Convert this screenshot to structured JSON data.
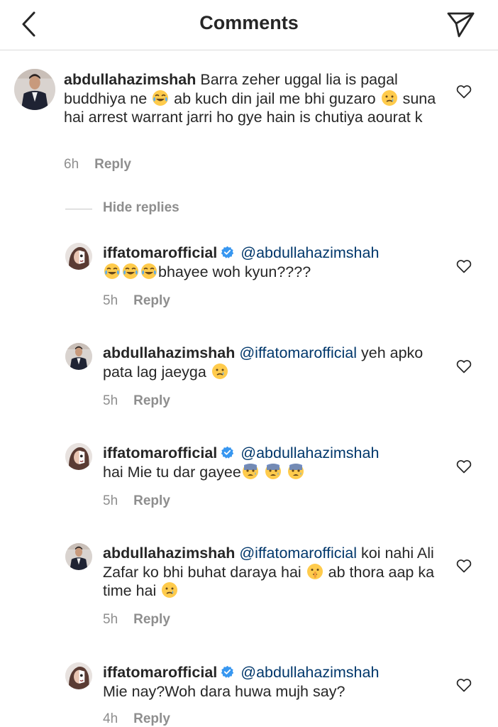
{
  "header": {
    "title": "Comments",
    "back_icon": "chevron-left-icon",
    "share_icon": "paper-plane-icon"
  },
  "hide_replies_label": "Hide replies",
  "reply_label": "Reply",
  "comment": {
    "username": "abdullahazimshah",
    "text_1": "Barra zeher uggal lia is pagal buddhiya ne",
    "text_2": "ab kuch din jail me bhi guzaro",
    "text_3": "suna hai arrest warrant jarri ho gye hain is chutiya aourat k",
    "time": "6h"
  },
  "replies": [
    {
      "username": "iffatomarofficial",
      "mention": "@abdullahazimshah",
      "text_after_emojis": "bhayee woh kyun????",
      "time": "5h"
    },
    {
      "username": "abdullahazimshah",
      "mention": "@iffatomarofficial",
      "text": "yeh apko pata lag jaeyga",
      "time": "5h"
    },
    {
      "username": "iffatomarofficial",
      "mention": "@abdullahazimshah",
      "text": "hai Mie tu dar gayee",
      "time": "5h"
    },
    {
      "username": "abdullahazimshah",
      "mention": "@iffatomarofficial",
      "text_1": "koi nahi Ali Zafar ko bhi buhat daraya hai",
      "text_2": "ab thora aap ka time hai",
      "time": "5h"
    },
    {
      "username": "iffatomarofficial",
      "mention": "@abdullahazimshah",
      "text": "Mie nay?Woh dara huwa mujh say?",
      "time": "4h"
    }
  ],
  "colors": {
    "text": "#262626",
    "secondary": "#8e8e8e",
    "mention": "#00376b",
    "verified": "#3897f0",
    "emoji": "#ffcb4c"
  }
}
